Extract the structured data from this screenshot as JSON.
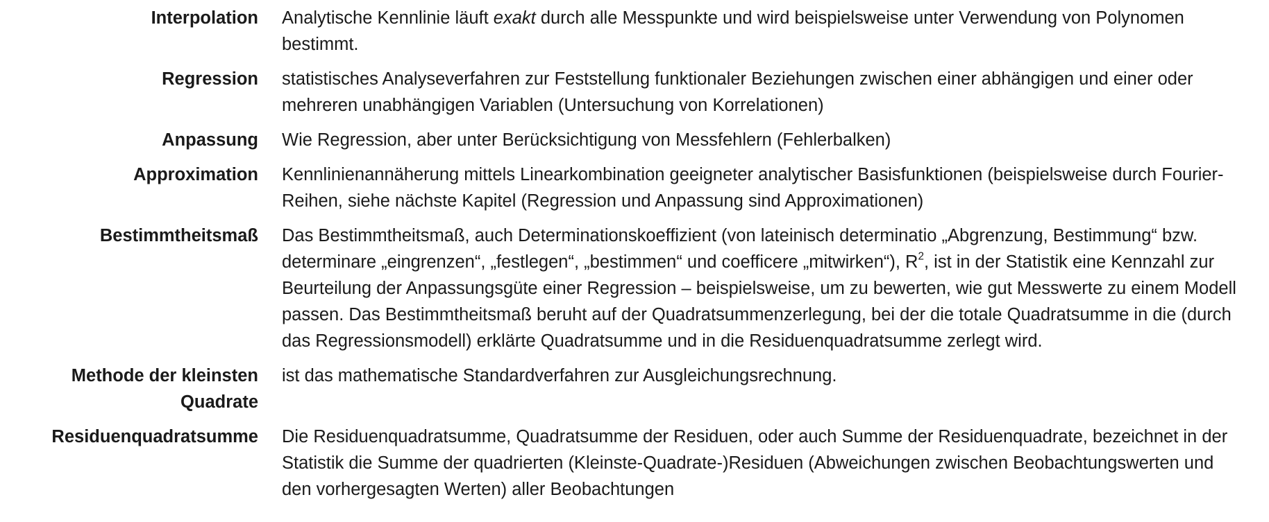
{
  "glossary": [
    {
      "term": "Interpolation",
      "definition_pre": "Analytische Kennlinie läuft ",
      "definition_em": "exakt",
      "definition_post": " durch alle Messpunkte und wird beispielsweise unter Verwendung von Polynomen bestimmt."
    },
    {
      "term": "Regression",
      "definition": "statistisches Analyseverfahren zur Feststellung funktionaler Beziehungen zwischen einer abhängigen und einer oder mehreren unabhängigen Variablen (Untersuchung von Korrelationen)"
    },
    {
      "term": "Anpassung",
      "definition": "Wie Regression, aber unter Berücksichtigung von Messfehlern (Fehlerbalken)"
    },
    {
      "term": "Approximation",
      "definition": "Kennlinienannäherung mittels Linearkombination geeigneter analytischer Basisfunktionen (beispielsweise durch Fourier-Reihen, siehe nächste Kapitel (Regression und Anpassung sind Approximationen)"
    },
    {
      "term": "Bestimmtheitsmaß",
      "definition_pre": "Das Bestimmtheitsmaß, auch Determinationskoeffizient (von lateinisch determinatio „Abgrenzung, Bestimmung“ bzw. determinare „eingrenzen“, „festlegen“, „bestimmen“ und coefficere „mitwirken“), R",
      "definition_sup": "2",
      "definition_post": ", ist in der Statistik eine Kennzahl zur Beurteilung der Anpassungsgüte einer Regression – beispielsweise, um zu bewerten, wie gut Messwerte zu einem Modell passen. Das Bestimmtheitsmaß beruht auf der Quadratsummenzerlegung, bei der die totale Quadratsumme in die (durch das Regressionsmodell) erklärte Quadratsumme und in die Residuenquadratsumme zerlegt wird."
    },
    {
      "term_line1": "Methode der kleinsten",
      "term_line2": "Quadrate",
      "definition": "ist das mathematische Standardverfahren zur Ausgleichungsrechnung."
    },
    {
      "term": "Residuenquadratsumme",
      "definition": "Die Residuenquadratsumme, Quadratsumme der Residuen, oder auch Summe der Residuenquadrate, bezeichnet in der Statistik die Summe der quadrierten (Kleinste-Quadrate-)Residuen (Abweichungen zwischen Beobachtungswerten und den vorhergesagten Werten) aller Beobachtungen"
    }
  ]
}
